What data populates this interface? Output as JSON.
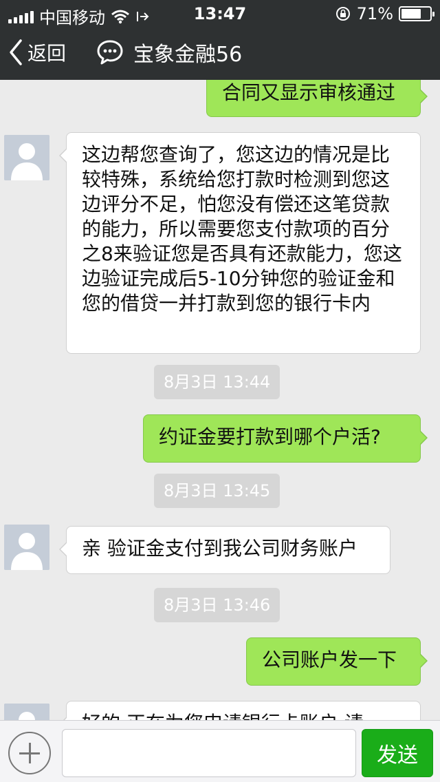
{
  "status_bar": {
    "carrier": "中国移动",
    "time": "13:47",
    "battery": "71%",
    "battery_level": 0.71
  },
  "nav": {
    "back_label": "返回",
    "title": "宝象金融56"
  },
  "messages": [
    {
      "type": "out",
      "text": "合同又显示审核通过"
    },
    {
      "type": "in",
      "text": "这边帮您查询了，您这边的情况是比较特殊，系统给您打款时检测到您这边评分不足，怕您没有偿还这笔贷款的能力，所以需要您支付款项的百分之8来验证您是否具有还款能力，您这边验证完成后5-10分钟您的验证金和您的借贷一并打款到您的银行卡内"
    },
    {
      "type": "time",
      "text": "8月3日 13:44"
    },
    {
      "type": "out",
      "text": "约证金要打款到哪个户活?"
    },
    {
      "type": "time",
      "text": "8月3日 13:45"
    },
    {
      "type": "in",
      "text": "亲 验证金支付到我公司财务账户"
    },
    {
      "type": "time",
      "text": "8月3日 13:46"
    },
    {
      "type": "out",
      "text": "公司账户发一下"
    },
    {
      "type": "in",
      "text": "好的 正在为您申请银行卡账户 请"
    }
  ],
  "input_bar": {
    "placeholder": "",
    "send_label": "发送"
  }
}
